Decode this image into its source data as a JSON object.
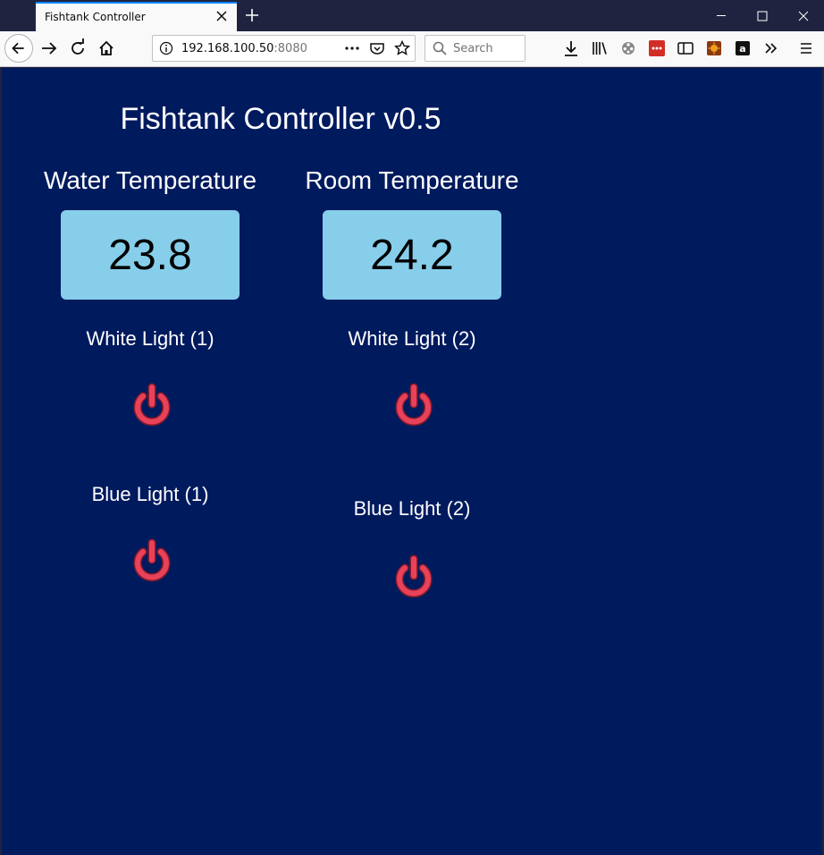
{
  "browser": {
    "tab_title": "Fishtank Controller",
    "url_host": "192.168.100.50",
    "url_port": ":8080",
    "search_placeholder": "Search"
  },
  "page": {
    "title": "Fishtank Controller v0.5",
    "water": {
      "label": "Water Temperature",
      "value": "23.8"
    },
    "room": {
      "label": "Room Temperature",
      "value": "24.2"
    },
    "lights": {
      "white1": "White Light (1)",
      "white2": "White Light (2)",
      "blue1": "Blue Light (1)",
      "blue2": "Blue Light (2)"
    }
  },
  "colors": {
    "page_bg": "#001a5e",
    "temp_box": "#87ceeb",
    "power_icon": "#e8425a"
  }
}
